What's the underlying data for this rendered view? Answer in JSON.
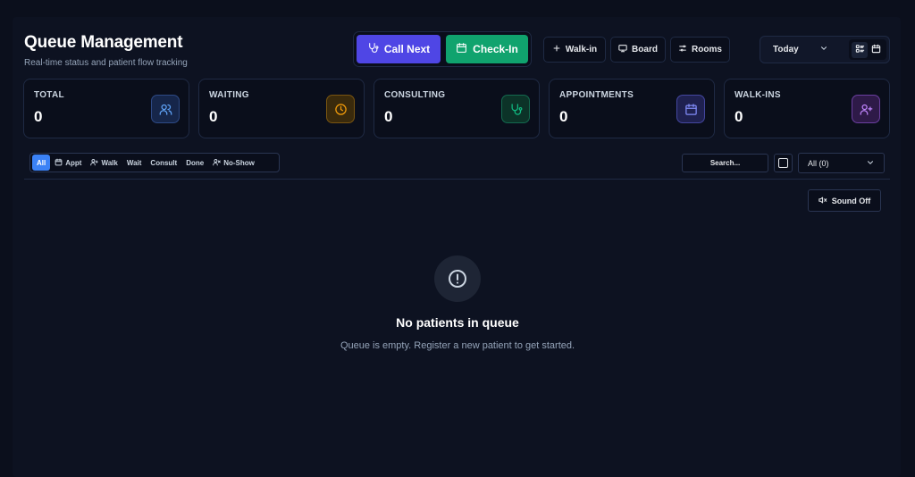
{
  "header": {
    "title": "Queue Management",
    "subtitle": "Real-time status and patient flow tracking"
  },
  "actions": {
    "call_next": "Call Next",
    "check_in": "Check-In",
    "walk_in": "Walk-in",
    "board": "Board",
    "rooms": "Rooms"
  },
  "date_filter": {
    "selected": "Today"
  },
  "stats": [
    {
      "label": "TOTAL",
      "value": "0",
      "icon": "users-icon",
      "color": "#60a5fa"
    },
    {
      "label": "WAITING",
      "value": "0",
      "icon": "clock-icon",
      "color": "#f59e0b"
    },
    {
      "label": "CONSULTING",
      "value": "0",
      "icon": "stethoscope-icon",
      "color": "#10b981"
    },
    {
      "label": "APPOINTMENTS",
      "value": "0",
      "icon": "calendar-icon",
      "color": "#818cf8"
    },
    {
      "label": "WALK-INS",
      "value": "0",
      "icon": "user-plus-icon",
      "color": "#c084fc"
    }
  ],
  "filters": {
    "chips": [
      "All",
      "Appt",
      "Walk",
      "Wait",
      "Consult",
      "Done",
      "No-Show"
    ],
    "active": "All",
    "search_placeholder": "Search...",
    "status_select": "All (0)"
  },
  "sound": {
    "label": "Sound Off"
  },
  "empty_state": {
    "title": "No patients in queue",
    "description": "Queue is empty. Register a new patient to get started."
  },
  "colors": {
    "call_next": "#4f46e5",
    "check_in": "#10a36e",
    "active_chip": "#3b82f6"
  }
}
